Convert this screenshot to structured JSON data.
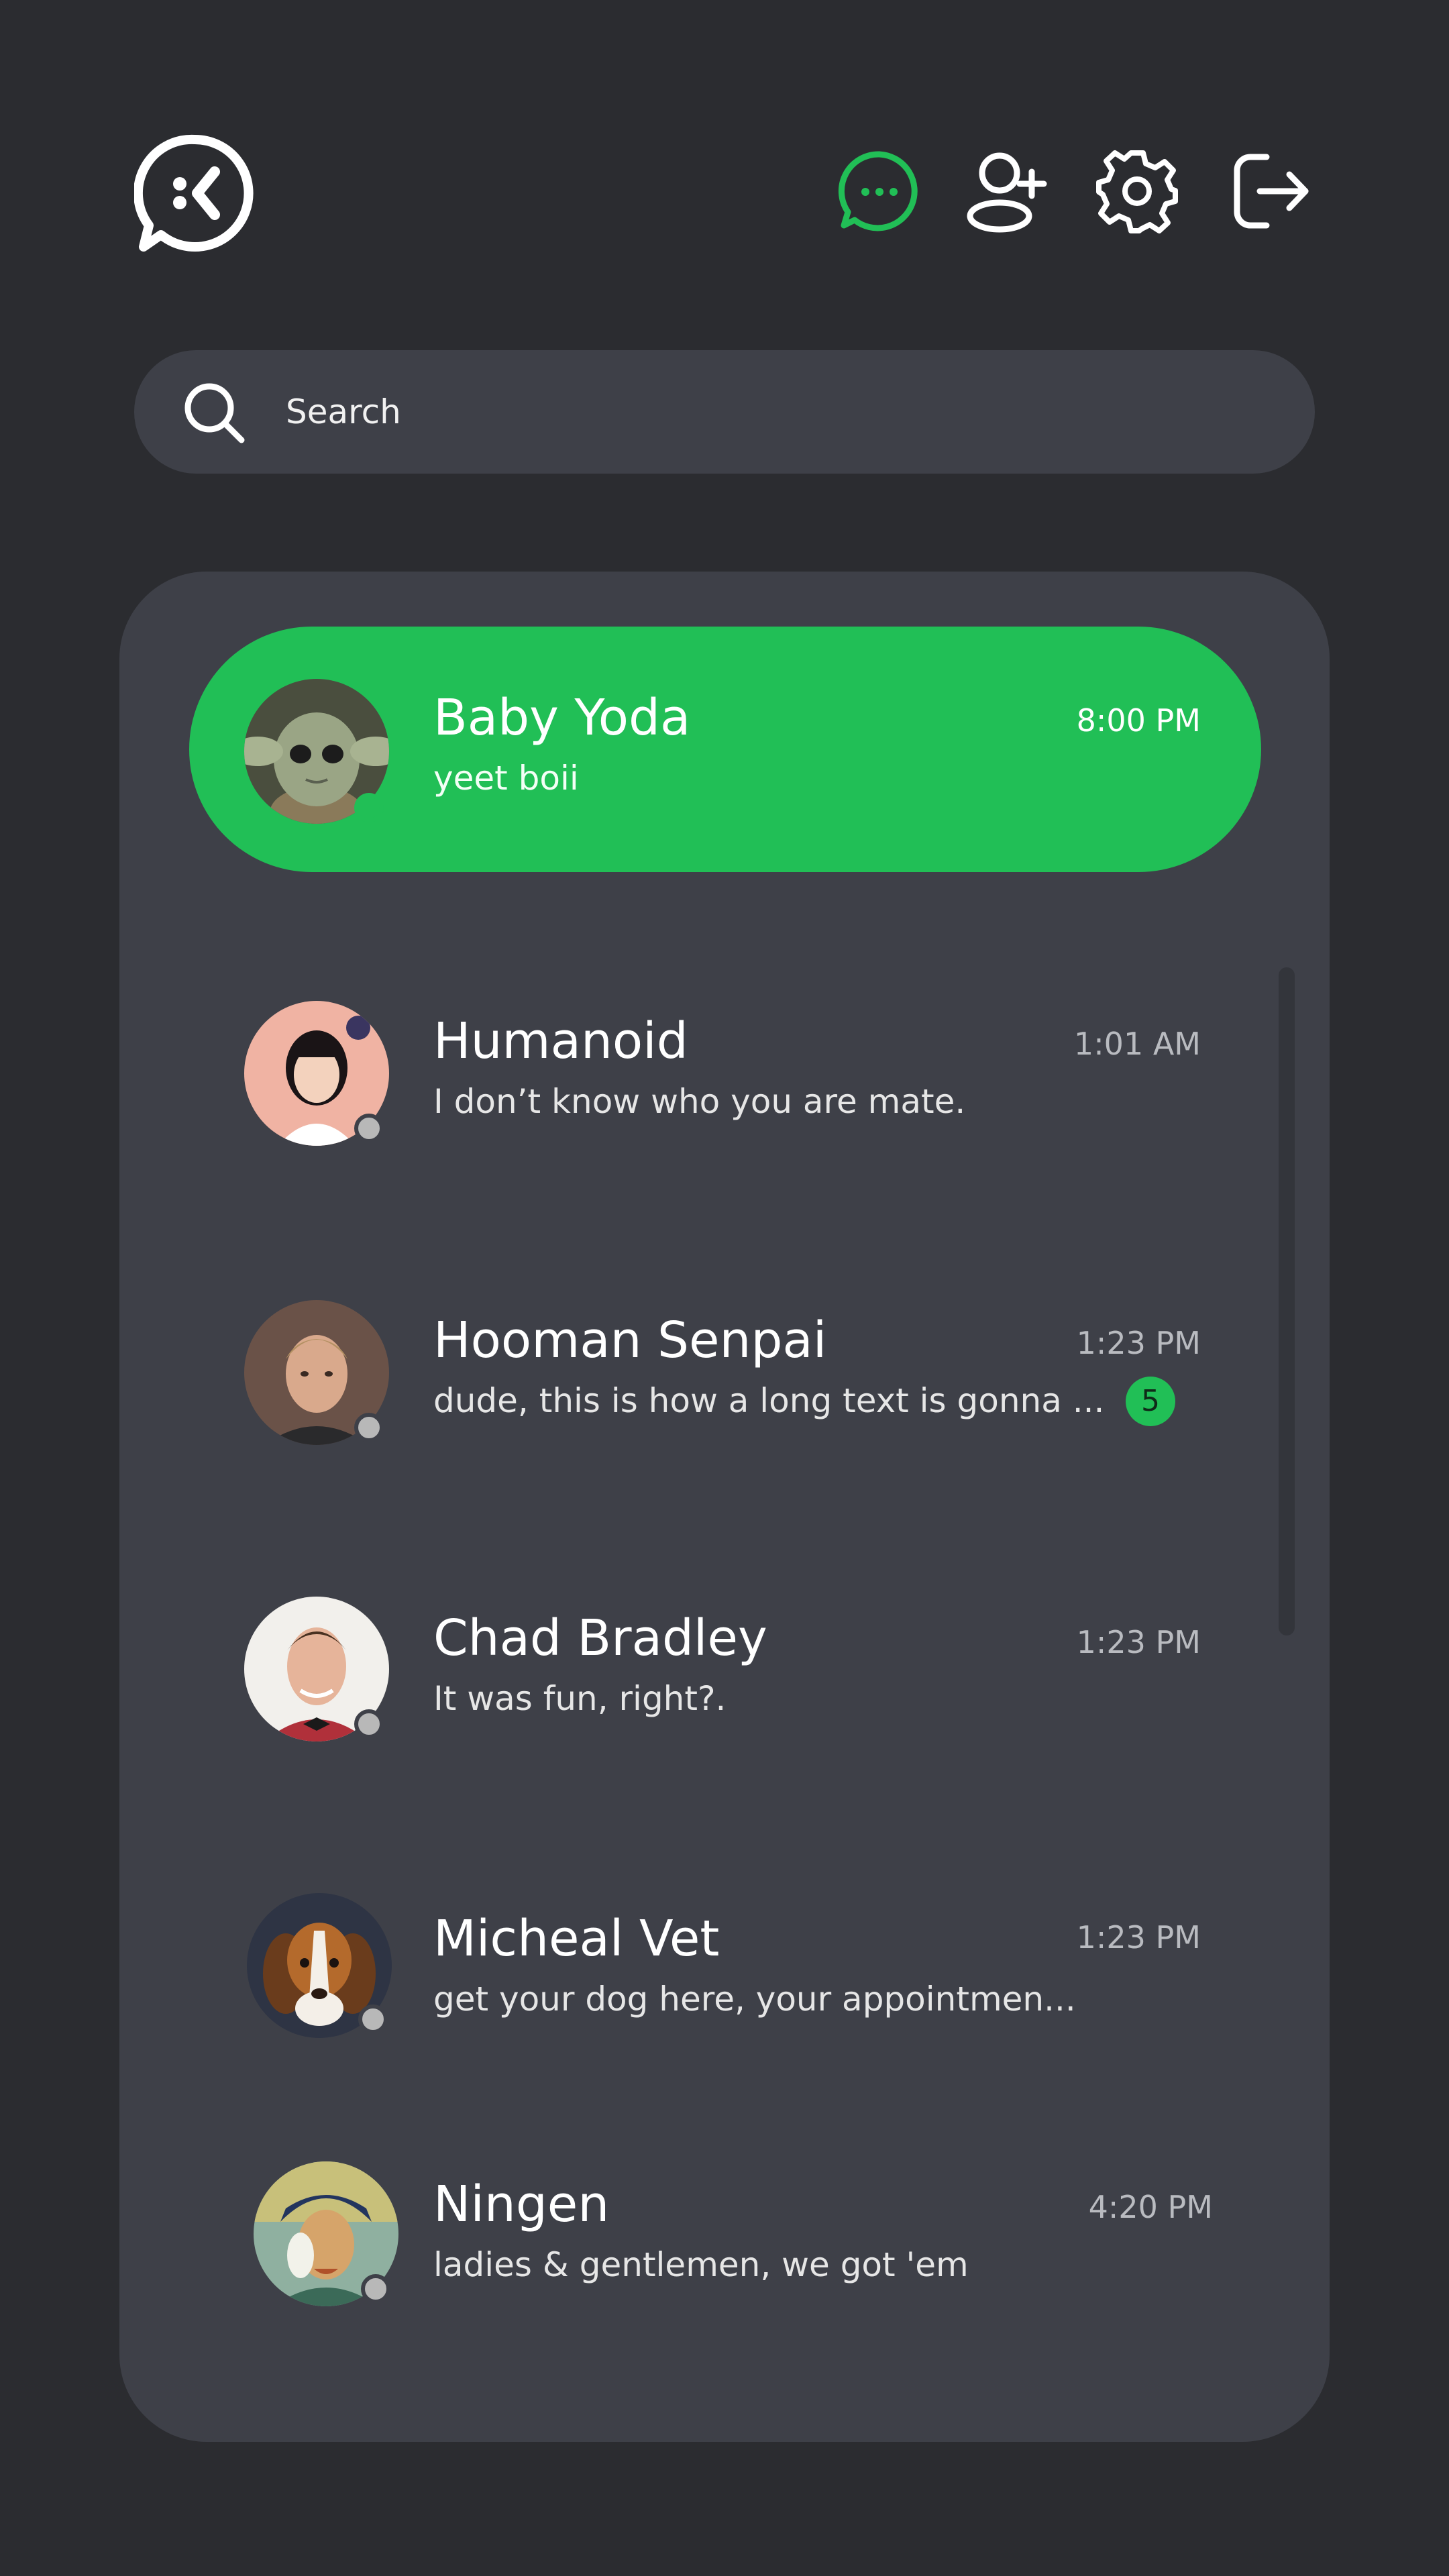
{
  "header": {
    "logo": "chat-logo-icon",
    "icons": [
      "chat-bubble-icon",
      "add-user-icon",
      "gear-icon",
      "logout-icon"
    ],
    "accent_color": "#21bf56"
  },
  "search": {
    "placeholder": "Search",
    "icon": "search-icon"
  },
  "chats": [
    {
      "name": "Baby Yoda",
      "preview": "yeet boii",
      "time": "8:00 PM",
      "online": true,
      "active": true
    },
    {
      "name": "Humanoid",
      "preview": "I don’t know who you are mate.",
      "time": "1:01 AM",
      "online": false
    },
    {
      "name": "Hooman Senpai",
      "preview": "dude, this is how a long text is gonna ...",
      "time": "1:23 PM",
      "online": false,
      "unread": "5"
    },
    {
      "name": "Chad Bradley",
      "preview": "It was fun, right?.",
      "time": "1:23 PM",
      "online": false
    },
    {
      "name": "Micheal Vet",
      "preview": "get your dog here, your appointmen...",
      "time": "1:23 PM",
      "online": false
    },
    {
      "name": "Ningen",
      "preview": "ladies & gentlemen, we got 'em",
      "time": "4:20 PM",
      "online": false
    }
  ]
}
